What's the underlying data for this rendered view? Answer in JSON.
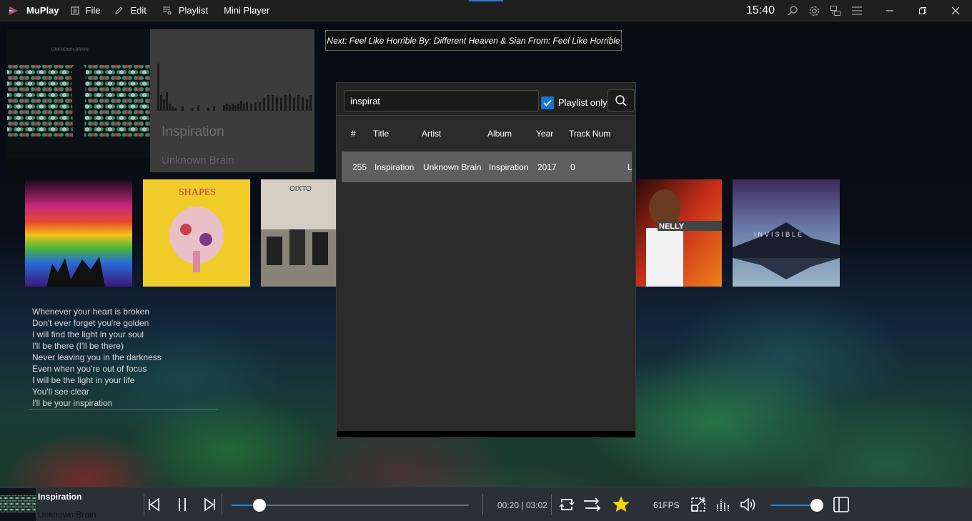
{
  "app": {
    "name": "MuPlay",
    "clock": "15:40"
  },
  "menu": [
    {
      "label": "File",
      "icon": "file-icon"
    },
    {
      "label": "Edit",
      "icon": "pencil-icon"
    },
    {
      "label": "Playlist",
      "icon": "playlist-icon"
    },
    {
      "label": "Mini Player",
      "icon": ""
    }
  ],
  "now_playing": {
    "title": "Inspiration",
    "artist": "Unknown Brain"
  },
  "next_banner": "Next: Feel Like Horrible By: Different Heaven & Sian From: Feel Like Horrible",
  "lyrics": [
    "Whenever your heart is broken",
    "Don't ever forget you're golden",
    "I will find the light in your soul",
    "I'll be there (I'll be there)",
    "Never leaving you in the darkness",
    "Even when you're out of focus",
    "I will be the light in your life",
    "You'll see clear",
    "I'll be your inspiration"
  ],
  "search": {
    "query": "inspirat",
    "playlist_only_label": "Playlist only",
    "playlist_only_checked": true,
    "columns": [
      "#",
      "Title",
      "Artist",
      "Album",
      "Year",
      "Track Num"
    ],
    "results": [
      {
        "num": "255",
        "title": "Inspiration",
        "artist": "Unknown Brain",
        "album": "Inspiration",
        "year": "2017",
        "track": "0",
        "extra": "L"
      }
    ]
  },
  "player": {
    "title": "Inspiration",
    "artist": "Unknown Brain",
    "time": "00:20 | 03:02",
    "progress": 0.11,
    "volume": 0.98,
    "fps": "61FPS",
    "favorite": true
  },
  "colors": {
    "accent": "#2b84d6",
    "star": "#f5d800",
    "checkbox": "#1a76d2"
  }
}
